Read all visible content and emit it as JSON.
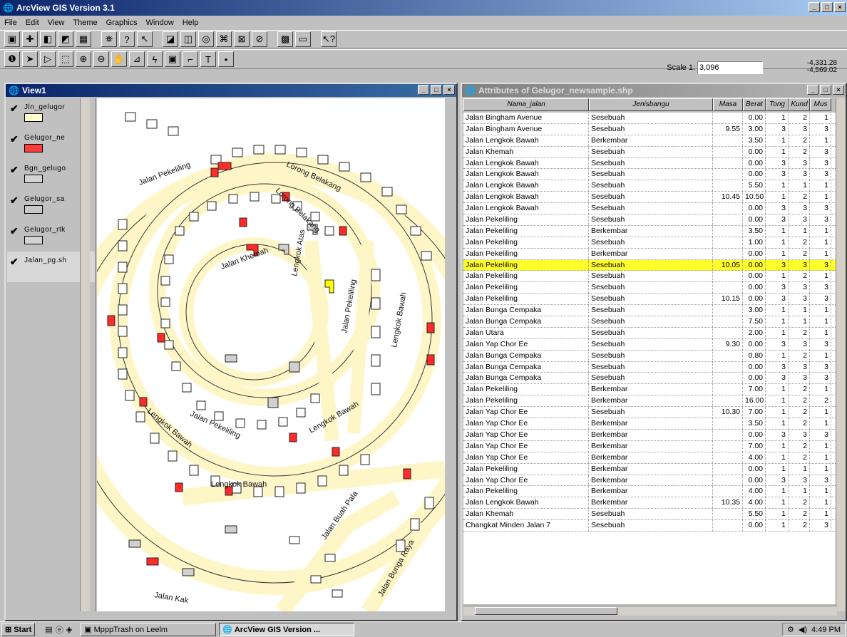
{
  "app": {
    "title": "ArcView GIS Version 3.1"
  },
  "menu": [
    "File",
    "Edit",
    "View",
    "Theme",
    "Graphics",
    "Window",
    "Help"
  ],
  "scale": {
    "label": "Scale 1:",
    "value": "3,096"
  },
  "coords": {
    "x": "-4,331.28",
    "y": "-4,569.02"
  },
  "view": {
    "title": "View1",
    "legend": [
      {
        "name": "Jln_gelugor",
        "color": "#ffffcc"
      },
      {
        "name": "Gelugor_ne",
        "color": "#ff3b3b"
      },
      {
        "name": "Bgn_gelugo",
        "color": "#d4d4d4"
      },
      {
        "name": "Gelugor_sa",
        "color": "#c8c8c8"
      },
      {
        "name": "Gelugor_rtk",
        "color": "#d4d4d4"
      },
      {
        "name": "Jalan_pg.sh",
        "color": null
      }
    ]
  },
  "table": {
    "title": "Attributes of Gelugor_newsample.shp",
    "columns": [
      "Nama_jalan",
      "Jenisbangu",
      "Masa",
      "Berat",
      "Tong",
      "Kund",
      "Mus"
    ],
    "rows": [
      [
        "Jalan Bingham Avenue",
        "Sesebuah",
        "",
        "0.00",
        "1",
        "2",
        "1"
      ],
      [
        "Jalan Bingham Avenue",
        "Sesebuah",
        "9.55",
        "3.00",
        "3",
        "3",
        "3"
      ],
      [
        "Jalan Lengkok Bawah",
        "Berkembar",
        "",
        "3.50",
        "1",
        "2",
        "1"
      ],
      [
        "Jalan Khemah",
        "Sesebuah",
        "",
        "0.00",
        "1",
        "2",
        "3"
      ],
      [
        "Jalan Lengkok Bawah",
        "Sesebuah",
        "",
        "0.00",
        "3",
        "3",
        "3"
      ],
      [
        "Jalan Lengkok Bawah",
        "Sesebuah",
        "",
        "0.00",
        "3",
        "3",
        "3"
      ],
      [
        "Jalan Lengkok Bawah",
        "Sesebuah",
        "",
        "5.50",
        "1",
        "1",
        "1"
      ],
      [
        "Jalan Lengkok Bawah",
        "Sesebuah",
        "10.45",
        "10.50",
        "1",
        "2",
        "1"
      ],
      [
        "Jalan Lengkok Bawah",
        "Sesebuah",
        "",
        "0.00",
        "3",
        "3",
        "3"
      ],
      [
        "Jalan Pekeliling",
        "Sesebuah",
        "",
        "0.00",
        "3",
        "3",
        "3"
      ],
      [
        "Jalan Pekeliling",
        "Berkembar",
        "",
        "3.50",
        "1",
        "1",
        "1"
      ],
      [
        "Jalan Pekeliling",
        "Sesebuah",
        "",
        "1.00",
        "1",
        "2",
        "1"
      ],
      [
        "Jalan Pekeliling",
        "Berkembar",
        "",
        "0.00",
        "1",
        "2",
        "1"
      ],
      [
        "Jalan Pekeliling",
        "Sesebuah",
        "10.05",
        "0.00",
        "3",
        "3",
        "3"
      ],
      [
        "Jalan Pekeliling",
        "Sesebuah",
        "",
        "0.00",
        "1",
        "2",
        "1"
      ],
      [
        "Jalan Pekeliling",
        "Sesebuah",
        "",
        "0.00",
        "3",
        "3",
        "3"
      ],
      [
        "Jalan Pekeliling",
        "Sesebuah",
        "10.15",
        "0.00",
        "3",
        "3",
        "3"
      ],
      [
        "Jalan Bunga Cempaka",
        "Sesebuah",
        "",
        "3.00",
        "1",
        "1",
        "1"
      ],
      [
        "Jalan Bunga Cempaka",
        "Sesebuah",
        "",
        "7.50",
        "1",
        "1",
        "1"
      ],
      [
        "Jalan Utara",
        "Sesebuah",
        "",
        "2.00",
        "1",
        "2",
        "1"
      ],
      [
        "Jalan Yap Chor Ee",
        "Sesebuah",
        "9.30",
        "0.00",
        "3",
        "3",
        "3"
      ],
      [
        "Jalan Bunga Cempaka",
        "Sesebuah",
        "",
        "0.80",
        "1",
        "2",
        "1"
      ],
      [
        "Jalan Bunga Cempaka",
        "Sesebuah",
        "",
        "0.00",
        "3",
        "3",
        "3"
      ],
      [
        "Jalan Bunga Cempaka",
        "Sesebuah",
        "",
        "0.00",
        "3",
        "3",
        "3"
      ],
      [
        "Jalan Pekeliling",
        "Berkembar",
        "",
        "7.00",
        "1",
        "2",
        "1"
      ],
      [
        "Jalan Pekeliling",
        "Berkembar",
        "",
        "16.00",
        "1",
        "2",
        "2"
      ],
      [
        "Jalan Yap Chor Ee",
        "Sesebuah",
        "10.30",
        "7.00",
        "1",
        "2",
        "1"
      ],
      [
        "Jalan Yap Chor Ee",
        "Berkembar",
        "",
        "3.50",
        "1",
        "2",
        "1"
      ],
      [
        "Jalan Yap Chor Ee",
        "Berkembar",
        "",
        "0.00",
        "3",
        "3",
        "3"
      ],
      [
        "Jalan Yap Chor Ee",
        "Berkembar",
        "",
        "7.00",
        "1",
        "2",
        "1"
      ],
      [
        "Jalan Yap Chor Ee",
        "Berkembar",
        "",
        "4.00",
        "1",
        "2",
        "1"
      ],
      [
        "Jalan Pekeliling",
        "Berkembar",
        "",
        "0.00",
        "1",
        "1",
        "1"
      ],
      [
        "Jalan Yap Chor Ee",
        "Berkembar",
        "",
        "0.00",
        "3",
        "3",
        "3"
      ],
      [
        "Jalan Pekeliling",
        "Berkembar",
        "",
        "4.00",
        "1",
        "1",
        "1"
      ],
      [
        "Jalan Lengkok Bawah",
        "Berkembar",
        "10.35",
        "4.00",
        "1",
        "2",
        "1"
      ],
      [
        "Jalan Khemah",
        "Sesebuah",
        "",
        "5.50",
        "1",
        "2",
        "1"
      ],
      [
        "Changkat Minden Jalan 7",
        "Sesebuah",
        "",
        "0.00",
        "1",
        "2",
        "3"
      ]
    ],
    "selected_row": 13,
    "selected_color": "#ffff2a"
  },
  "taskbar": {
    "start": "Start",
    "tasks": [
      "MpppTrash on Leelm",
      "ArcView GIS Version ..."
    ],
    "clock": "4:49 PM"
  }
}
